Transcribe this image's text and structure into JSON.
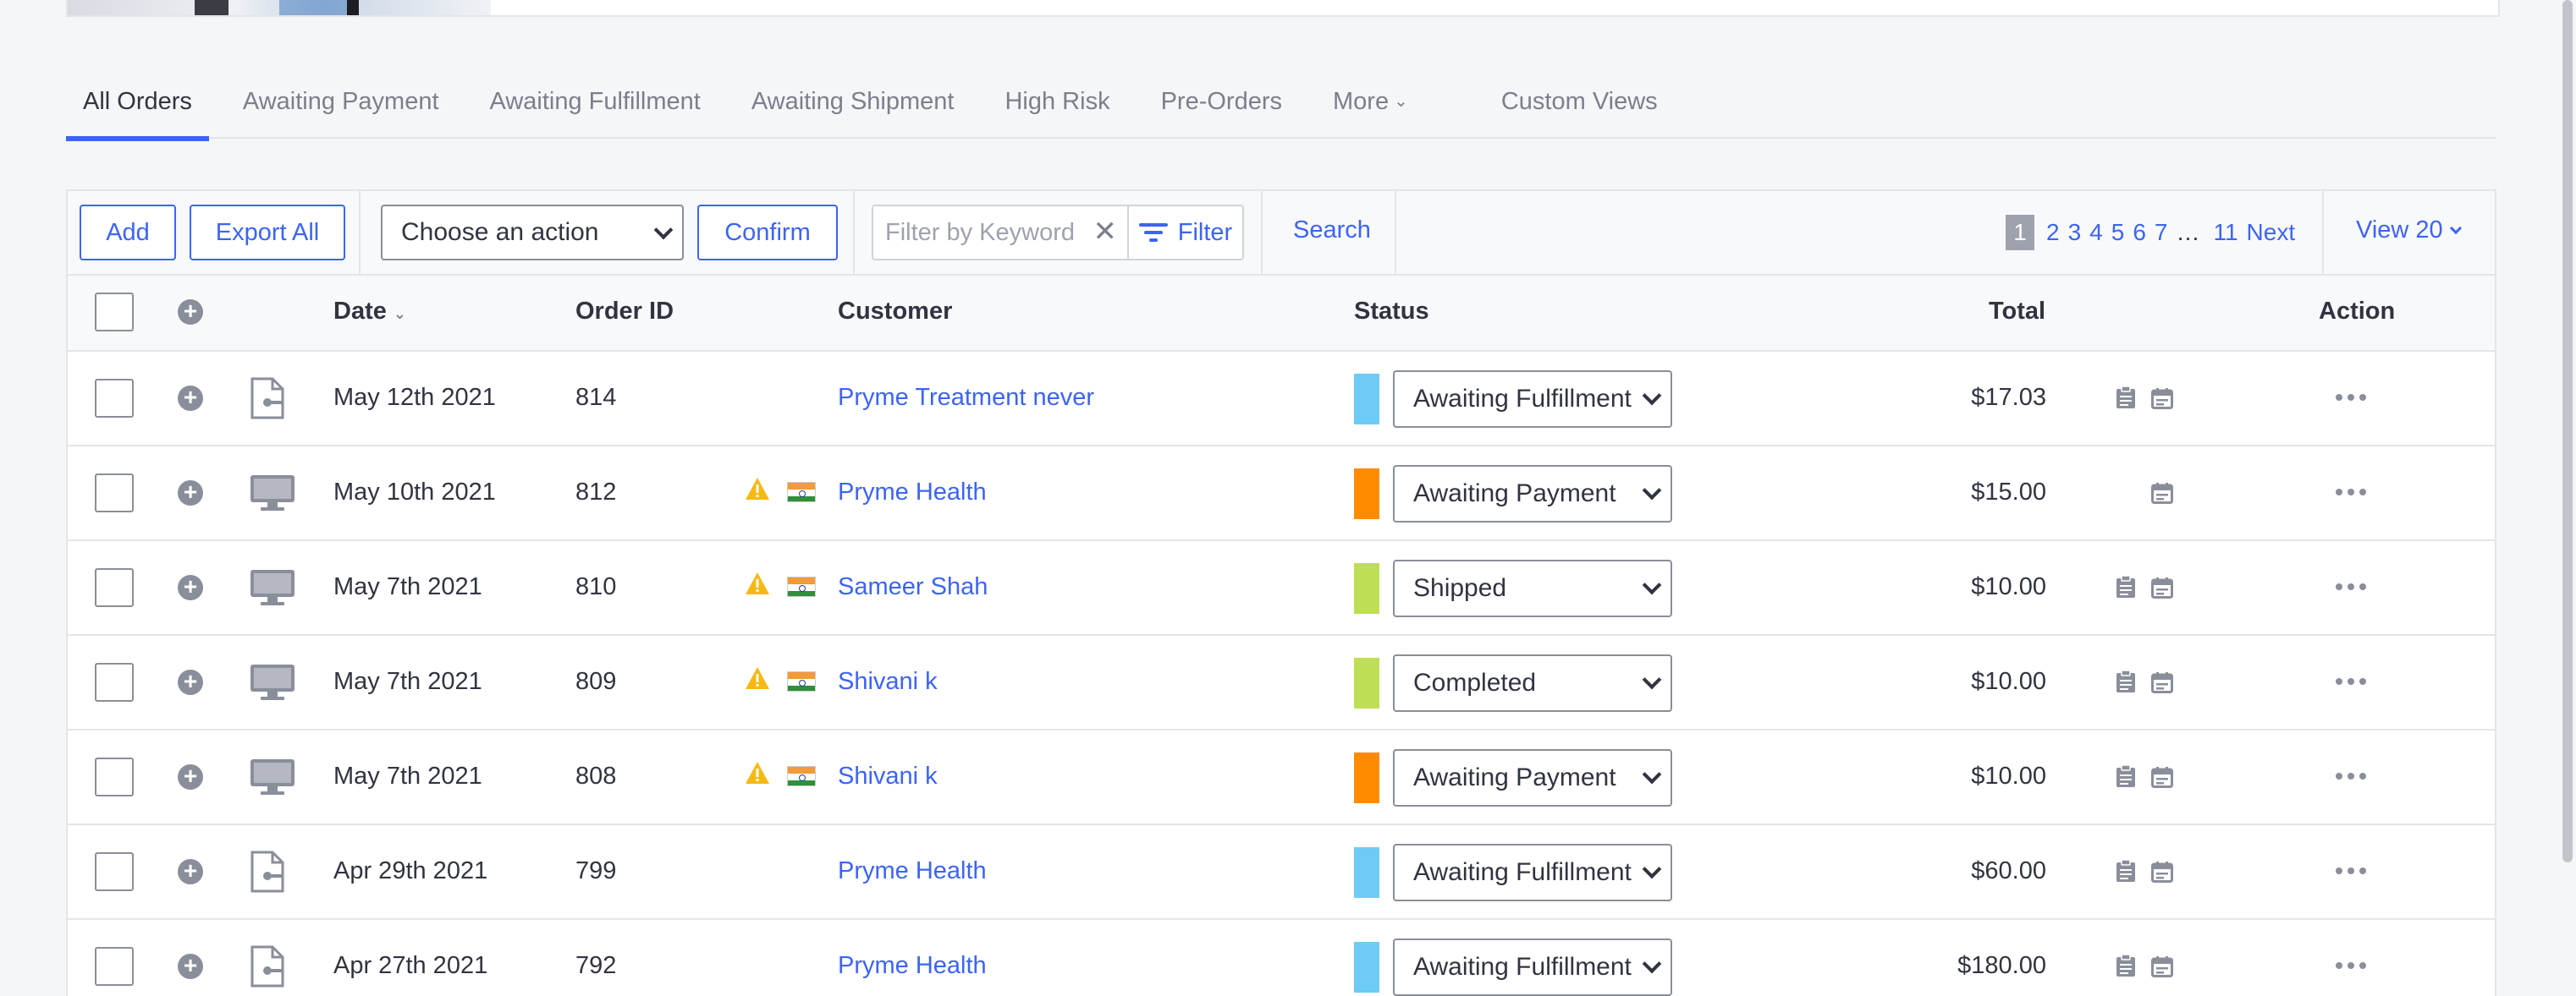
{
  "tabs": [
    {
      "label": "All Orders",
      "active": true
    },
    {
      "label": "Awaiting Payment"
    },
    {
      "label": "Awaiting Fulfillment"
    },
    {
      "label": "Awaiting Shipment"
    },
    {
      "label": "High Risk"
    },
    {
      "label": "Pre-Orders"
    },
    {
      "label": "More"
    },
    {
      "label": "Custom Views"
    }
  ],
  "toolbar": {
    "add_label": "Add",
    "export_label": "Export All",
    "action_select": "Choose an action",
    "confirm_label": "Confirm",
    "filter_placeholder": "Filter by Keyword",
    "filter_label": "Filter",
    "search_label": "Search",
    "pages": [
      "1",
      "2",
      "3",
      "4",
      "5",
      "6",
      "7"
    ],
    "ellipsis": "…",
    "last_page": "11",
    "next_label": "Next",
    "view_label": "View 20",
    "current_page": "1"
  },
  "columns": {
    "date": "Date",
    "order_id": "Order ID",
    "customer": "Customer",
    "status": "Status",
    "total": "Total",
    "action": "Action"
  },
  "orders": [
    {
      "date": "May 12th 2021",
      "id": "814",
      "customer": "Pryme Treatment never",
      "status": "Awaiting Fulfillment",
      "status_color": "#6ecbf5",
      "total": "$17.03",
      "channel": "document-icon",
      "warning": false,
      "flag": false,
      "notes": true
    },
    {
      "date": "May 10th 2021",
      "id": "812",
      "customer": "Pryme Health",
      "status": "Awaiting Payment",
      "status_color": "#ff8c00",
      "total": "$15.00",
      "channel": "monitor-icon",
      "warning": true,
      "flag": true,
      "notes": false
    },
    {
      "date": "May 7th 2021",
      "id": "810",
      "customer": "Sameer Shah",
      "status": "Shipped",
      "status_color": "#bedf55",
      "total": "$10.00",
      "channel": "monitor-icon",
      "warning": true,
      "flag": true,
      "notes": true
    },
    {
      "date": "May 7th 2021",
      "id": "809",
      "customer": "Shivani k",
      "status": "Completed",
      "status_color": "#bedf55",
      "total": "$10.00",
      "channel": "monitor-icon",
      "warning": true,
      "flag": true,
      "notes": true
    },
    {
      "date": "May 7th 2021",
      "id": "808",
      "customer": "Shivani k",
      "status": "Awaiting Payment",
      "status_color": "#ff8c00",
      "total": "$10.00",
      "channel": "monitor-icon",
      "warning": true,
      "flag": true,
      "notes": true
    },
    {
      "date": "Apr 29th 2021",
      "id": "799",
      "customer": "Pryme Health",
      "status": "Awaiting Fulfillment",
      "status_color": "#6ecbf5",
      "total": "$60.00",
      "channel": "document-icon",
      "warning": false,
      "flag": false,
      "notes": true
    },
    {
      "date": "Apr 27th 2021",
      "id": "792",
      "customer": "Pryme Health",
      "status": "Awaiting Fulfillment",
      "status_color": "#6ecbf5",
      "total": "$180.00",
      "channel": "document-icon",
      "warning": false,
      "flag": false,
      "notes": true
    }
  ]
}
